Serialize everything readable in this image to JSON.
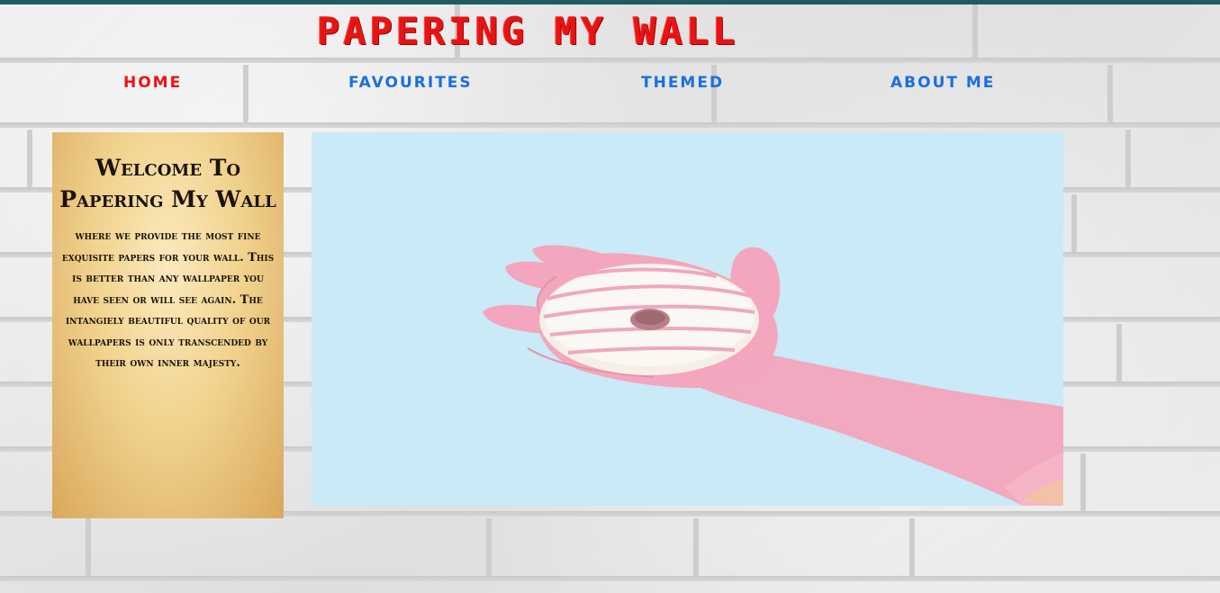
{
  "site": {
    "title": "PAPERING MY WALL"
  },
  "nav": {
    "items": [
      {
        "label": "HOME",
        "active": true
      },
      {
        "label": "FAVOURITES",
        "active": false
      },
      {
        "label": "THEMED",
        "active": false
      },
      {
        "label": "ABOUT ME",
        "active": false
      }
    ]
  },
  "welcome": {
    "heading": "Welcome To Papering My Wall",
    "body": "where we provide the most fine exquisite papers for your wall. This is better than any wallpaper you have seen or will see again. The intangiely beautiful quality of our wallpapers is only transcended by their own inner majesty."
  },
  "hero": {
    "subject": "pink-gloved hand holding a frosted donut",
    "background_color": "#c9eaf6"
  },
  "colors": {
    "top_bar": "#1f5c63",
    "title": "#e81414",
    "nav_active": "#e81414",
    "nav_link": "#1a6fe0"
  }
}
